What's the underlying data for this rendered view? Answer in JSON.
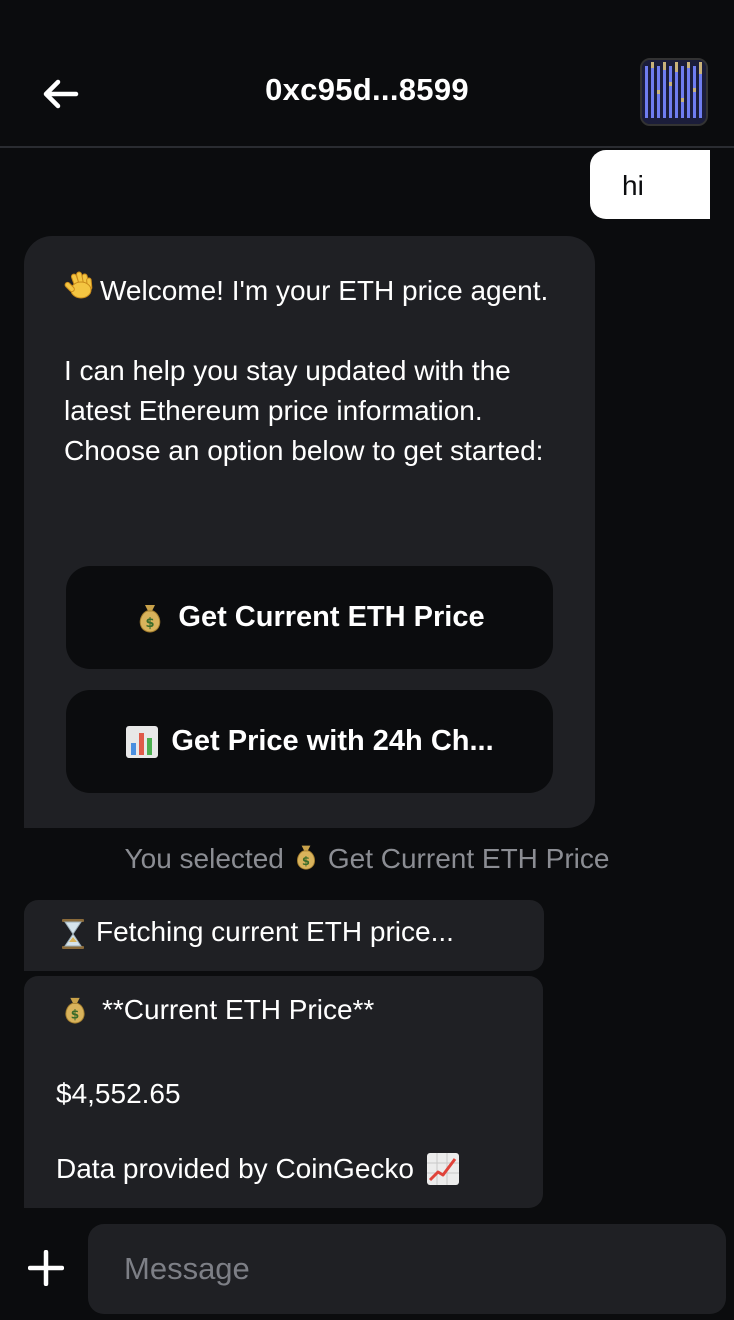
{
  "header": {
    "title": "0xc95d...8599",
    "back_icon": "arrow-left-icon",
    "avatar_icon": "pixel-avatar"
  },
  "messages": {
    "user_message": "hi",
    "welcome": {
      "line1": "Welcome! I'm your ETH price agent.",
      "line2": "I can help you stay updated with the latest Ethereum price information. Choose an option below to get started:",
      "icon": "waving-hand-icon"
    },
    "options": [
      {
        "label": "Get Current ETH Price",
        "icon": "money-bag-icon"
      },
      {
        "label": "Get Price with 24h Ch...",
        "icon": "bar-chart-icon"
      }
    ],
    "selection_note": {
      "prefix": "You selected",
      "choice": "Get Current ETH Price",
      "icon": "money-bag-icon"
    },
    "fetching": {
      "text": "Fetching current ETH price...",
      "icon": "hourglass-icon"
    },
    "price_result": {
      "title": "**Current ETH Price**",
      "value": "$4,552.65",
      "source": "Data provided by CoinGecko",
      "title_icon": "money-bag-icon",
      "source_icon": "chart-increasing-icon"
    }
  },
  "composer": {
    "placeholder": "Message",
    "plus_icon": "plus-icon"
  },
  "colors": {
    "background": "#0b0c0e",
    "bubble": "#1f2024",
    "user_bubble": "#ffffff",
    "muted_text": "#8b8d93"
  }
}
